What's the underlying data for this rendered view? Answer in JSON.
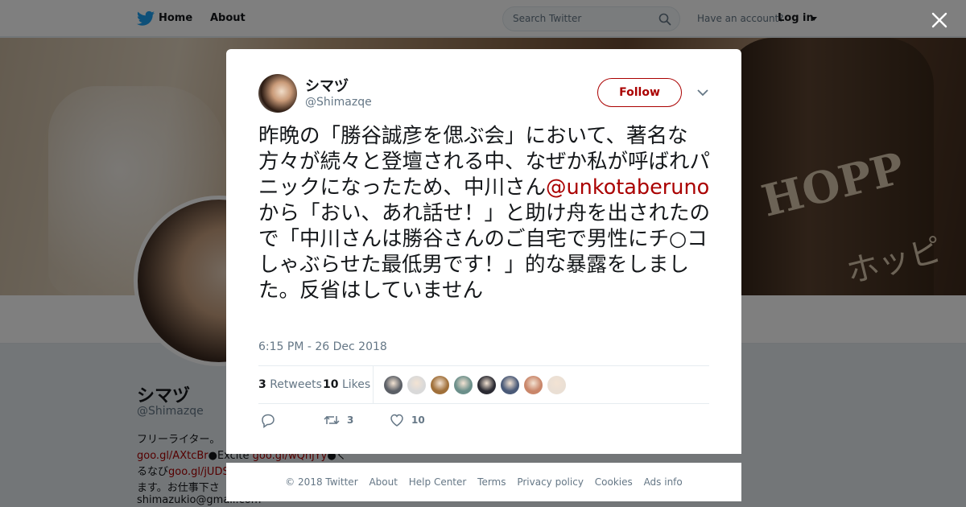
{
  "nav": {
    "home": "Home",
    "about": "About",
    "search_placeholder": "Search Twitter",
    "have_account": "Have an account?",
    "login": "Log in"
  },
  "profile": {
    "name": "シマヅ",
    "handle": "@Shimazqe",
    "bio_line1": "フリーライター。",
    "bio_link1": "goo.gl/AXtcBr",
    "bio_text2": "●Excite",
    "bio_link2": "goo.gl/wQnjYy",
    "bio_text3": "●く",
    "bio_line3_prefix": "るなび",
    "bio_link3": "goo.gl/jUDS",
    "bio_line4": "ます。お仕事下さ",
    "bio_line5": "shimazukio@gmail.com"
  },
  "cover": {
    "label": "HOPP",
    "label2": "ホッピ"
  },
  "tweet": {
    "author_name": "シマヅ",
    "author_handle": "@Shimazqe",
    "follow_label": "Follow",
    "text_part1": "昨晩の「勝谷誠彦を偲ぶ会」において、著名な方々が続々と登壇される中、なぜか私が呼ばれパニックになったため、中川さん",
    "mention": "@unkotaberuno",
    "text_part2": "から「おい、あれ話せ！」と助け舟を出されたので「中川さんは勝谷さんのご自宅で男性にチ○コしゃぶらせた最低男です！」的な暴露をしました。反省はしていません",
    "timestamp": "6:15 PM - 26 Dec 2018",
    "retweets_count": "3",
    "retweets_label": "Retweets",
    "likes_count": "10",
    "likes_label": "Likes",
    "action_retweet_count": "3",
    "action_like_count": "10",
    "liker_colors": [
      "#5b5f66",
      "#d9d9d9",
      "#a0703a",
      "#6b8f8a",
      "#2b2b33",
      "#4a5a78",
      "#c9866a",
      "#eadfd4"
    ]
  },
  "footer": {
    "copyright": "© 2018 Twitter",
    "about": "About",
    "help": "Help Center",
    "terms": "Terms",
    "privacy": "Privacy policy",
    "cookies": "Cookies",
    "ads": "Ads info"
  },
  "colors": {
    "accent": "#aa0000",
    "twitter_blue": "#1da1f2",
    "muted": "#657786"
  }
}
